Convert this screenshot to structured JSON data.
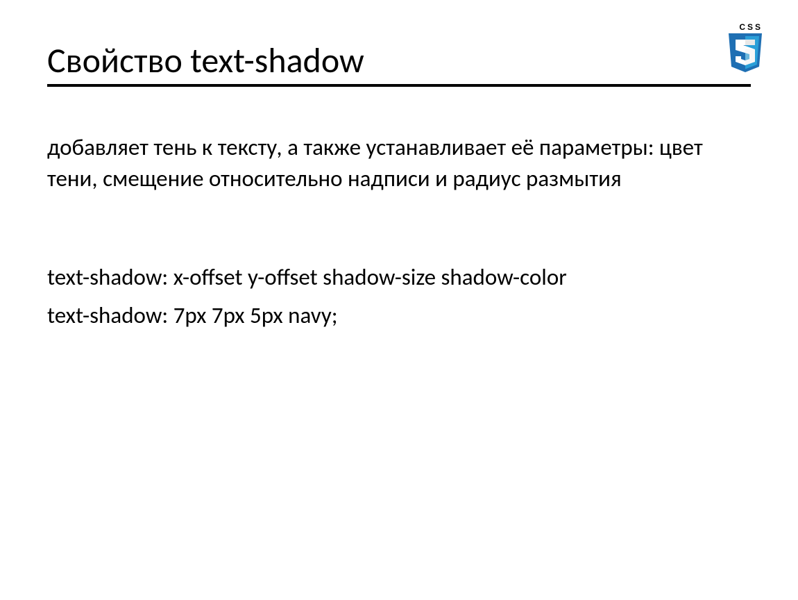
{
  "logo": {
    "text": "CSS"
  },
  "title": "Свойство text-shadow",
  "description": "добавляет тень к тексту, а также устанавливает её параметры: цвет тени, смещение относительно надписи и радиус размытия",
  "syntax": "text-shadow: x-offset y-offset shadow-size shadow-color",
  "example": "text-shadow: 7px 7px 5px navy;"
}
